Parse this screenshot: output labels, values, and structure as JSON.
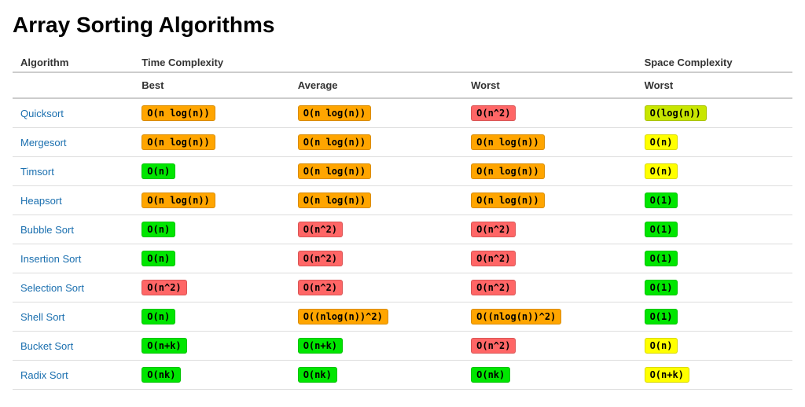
{
  "title": "Array Sorting Algorithms",
  "columns": {
    "algorithm": "Algorithm",
    "time_complexity": "Time Complexity",
    "space_complexity": "Space Complexity",
    "best": "Best",
    "average": "Average",
    "worst_tc": "Worst",
    "worst_sc": "Worst"
  },
  "rows": [
    {
      "name": "Quicksort",
      "best": {
        "label": "O(n log(n))",
        "color": "orange"
      },
      "average": {
        "label": "O(n log(n))",
        "color": "orange"
      },
      "worst_tc": {
        "label": "O(n^2)",
        "color": "red"
      },
      "worst_sc": {
        "label": "O(log(n))",
        "color": "yellow-green"
      }
    },
    {
      "name": "Mergesort",
      "best": {
        "label": "O(n log(n))",
        "color": "orange"
      },
      "average": {
        "label": "O(n log(n))",
        "color": "orange"
      },
      "worst_tc": {
        "label": "O(n log(n))",
        "color": "orange"
      },
      "worst_sc": {
        "label": "O(n)",
        "color": "yellow"
      }
    },
    {
      "name": "Timsort",
      "best": {
        "label": "O(n)",
        "color": "green"
      },
      "average": {
        "label": "O(n log(n))",
        "color": "orange"
      },
      "worst_tc": {
        "label": "O(n log(n))",
        "color": "orange"
      },
      "worst_sc": {
        "label": "O(n)",
        "color": "yellow"
      }
    },
    {
      "name": "Heapsort",
      "best": {
        "label": "O(n log(n))",
        "color": "orange"
      },
      "average": {
        "label": "O(n log(n))",
        "color": "orange"
      },
      "worst_tc": {
        "label": "O(n log(n))",
        "color": "orange"
      },
      "worst_sc": {
        "label": "O(1)",
        "color": "green"
      }
    },
    {
      "name": "Bubble Sort",
      "best": {
        "label": "O(n)",
        "color": "green"
      },
      "average": {
        "label": "O(n^2)",
        "color": "red"
      },
      "worst_tc": {
        "label": "O(n^2)",
        "color": "red"
      },
      "worst_sc": {
        "label": "O(1)",
        "color": "green"
      }
    },
    {
      "name": "Insertion Sort",
      "best": {
        "label": "O(n)",
        "color": "green"
      },
      "average": {
        "label": "O(n^2)",
        "color": "red"
      },
      "worst_tc": {
        "label": "O(n^2)",
        "color": "red"
      },
      "worst_sc": {
        "label": "O(1)",
        "color": "green"
      }
    },
    {
      "name": "Selection Sort",
      "best": {
        "label": "O(n^2)",
        "color": "red"
      },
      "average": {
        "label": "O(n^2)",
        "color": "red"
      },
      "worst_tc": {
        "label": "O(n^2)",
        "color": "red"
      },
      "worst_sc": {
        "label": "O(1)",
        "color": "green"
      }
    },
    {
      "name": "Shell Sort",
      "best": {
        "label": "O(n)",
        "color": "green"
      },
      "average": {
        "label": "O((nlog(n))^2)",
        "color": "orange"
      },
      "worst_tc": {
        "label": "O((nlog(n))^2)",
        "color": "orange"
      },
      "worst_sc": {
        "label": "O(1)",
        "color": "green"
      }
    },
    {
      "name": "Bucket Sort",
      "best": {
        "label": "O(n+k)",
        "color": "green"
      },
      "average": {
        "label": "O(n+k)",
        "color": "green"
      },
      "worst_tc": {
        "label": "O(n^2)",
        "color": "red"
      },
      "worst_sc": {
        "label": "O(n)",
        "color": "yellow"
      }
    },
    {
      "name": "Radix Sort",
      "best": {
        "label": "O(nk)",
        "color": "green"
      },
      "average": {
        "label": "O(nk)",
        "color": "green"
      },
      "worst_tc": {
        "label": "O(nk)",
        "color": "green"
      },
      "worst_sc": {
        "label": "O(n+k)",
        "color": "yellow"
      }
    }
  ]
}
